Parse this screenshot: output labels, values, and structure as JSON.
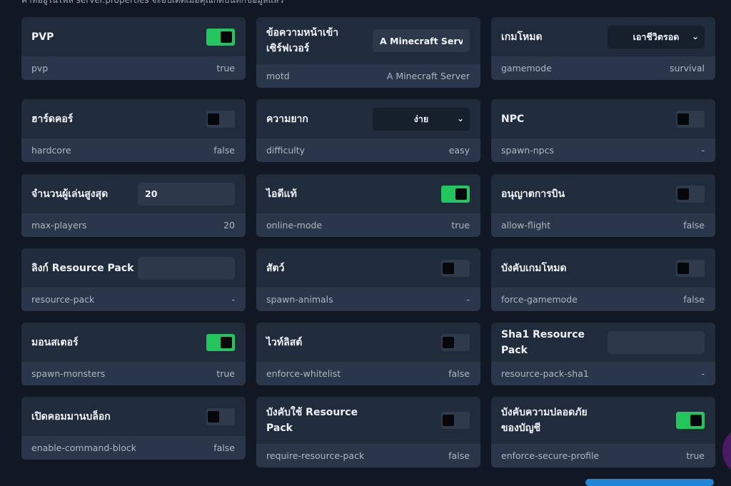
{
  "header_note": "ค่าที่อยู่ในไฟล์ server.properties จะอัปเดตเมื่อคุณกดบันทึกข้อมูลแล้ว",
  "cards": [
    {
      "label": "PVP",
      "key": "pvp",
      "value": "true",
      "control": "toggle",
      "on": true
    },
    {
      "label": "ข้อความหน้าเข้าเซิร์ฟเวอร์",
      "key": "motd",
      "value": "A Minecraft Server",
      "control": "text",
      "input_value": "A Minecraft Server"
    },
    {
      "label": "เกมโหมด",
      "key": "gamemode",
      "value": "survival",
      "control": "select",
      "selected": "เอาชีวิตรอด"
    },
    {
      "label": "ฮาร์ดคอร์",
      "key": "hardcore",
      "value": "false",
      "control": "toggle",
      "on": false
    },
    {
      "label": "ความยาก",
      "key": "difficulty",
      "value": "easy",
      "control": "select",
      "selected": "ง่าย"
    },
    {
      "label": "NPC",
      "key": "spawn-npcs",
      "value": "-",
      "control": "toggle",
      "on": false
    },
    {
      "label": "จำนวนผู้เล่นสูงสุด",
      "key": "max-players",
      "value": "20",
      "control": "text",
      "input_value": "20"
    },
    {
      "label": "ไอดีแท้",
      "key": "online-mode",
      "value": "true",
      "control": "toggle",
      "on": true
    },
    {
      "label": "อนุญาตการบิน",
      "key": "allow-flight",
      "value": "false",
      "control": "toggle",
      "on": false
    },
    {
      "label": "ลิงก์ Resource Pack",
      "key": "resource-pack",
      "value": "-",
      "control": "text",
      "input_value": ""
    },
    {
      "label": "สัตว์",
      "key": "spawn-animals",
      "value": "-",
      "control": "toggle",
      "on": false
    },
    {
      "label": "บังคับเกมโหมด",
      "key": "force-gamemode",
      "value": "false",
      "control": "toggle",
      "on": false
    },
    {
      "label": "มอนสเตอร์",
      "key": "spawn-monsters",
      "value": "true",
      "control": "toggle",
      "on": true
    },
    {
      "label": "ไวท์ลิสต์",
      "key": "enforce-whitelist",
      "value": "false",
      "control": "toggle",
      "on": false
    },
    {
      "label": "Sha1 Resource Pack",
      "key": "resource-pack-sha1",
      "value": "-",
      "control": "text",
      "input_value": ""
    },
    {
      "label": "เปิดคอมมานบล็อก",
      "key": "enable-command-block",
      "value": "false",
      "control": "toggle",
      "on": false
    },
    {
      "label": "บังคับใช้ Resource Pack",
      "key": "require-resource-pack",
      "value": "false",
      "control": "toggle",
      "on": false
    },
    {
      "label": "บังคับความปลอดภัยของบัญชี",
      "key": "enforce-secure-profile",
      "value": "true",
      "control": "toggle",
      "on": true
    }
  ],
  "colors": {
    "toggle_on": "#22c55e",
    "card_bg": "#202b3b",
    "card_footer": "#2a3649",
    "page_bg": "#111823"
  },
  "icons": {
    "select_chevron": "chevron-down-icon"
  }
}
